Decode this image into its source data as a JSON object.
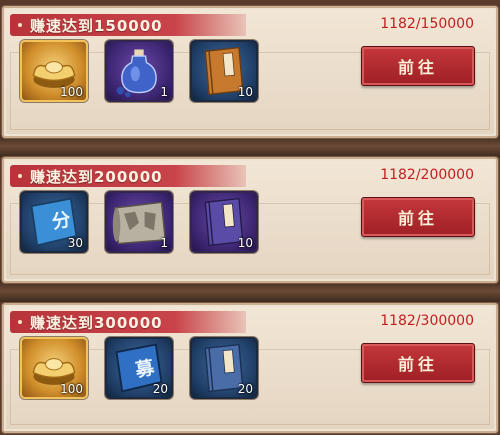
{
  "tasks": [
    {
      "title": "赚速达到150000",
      "progress": "1182/150000",
      "button": "前往",
      "rewards": [
        {
          "icon": "gold-ingot-icon",
          "count": "100",
          "frame": "gold"
        },
        {
          "icon": "blue-potion-bottle-icon",
          "count": "1",
          "frame": "purple"
        },
        {
          "icon": "orange-book-icon",
          "count": "10",
          "frame": "blue"
        }
      ]
    },
    {
      "title": "赚速达到200000",
      "progress": "1182/200000",
      "button": "前往",
      "rewards": [
        {
          "icon": "blue-card-icon",
          "count": "30",
          "frame": "blue"
        },
        {
          "icon": "map-scroll-icon",
          "count": "1",
          "frame": "purple"
        },
        {
          "icon": "purple-book-icon",
          "count": "10",
          "frame": "purple"
        }
      ]
    },
    {
      "title": "赚速达到300000",
      "progress": "1182/300000",
      "button": "前往",
      "rewards": [
        {
          "icon": "gold-ingot-icon",
          "count": "100",
          "frame": "gold"
        },
        {
          "icon": "blue-card-icon",
          "count": "20",
          "frame": "blue"
        },
        {
          "icon": "blue-book-icon",
          "count": "20",
          "frame": "blue"
        }
      ]
    }
  ]
}
